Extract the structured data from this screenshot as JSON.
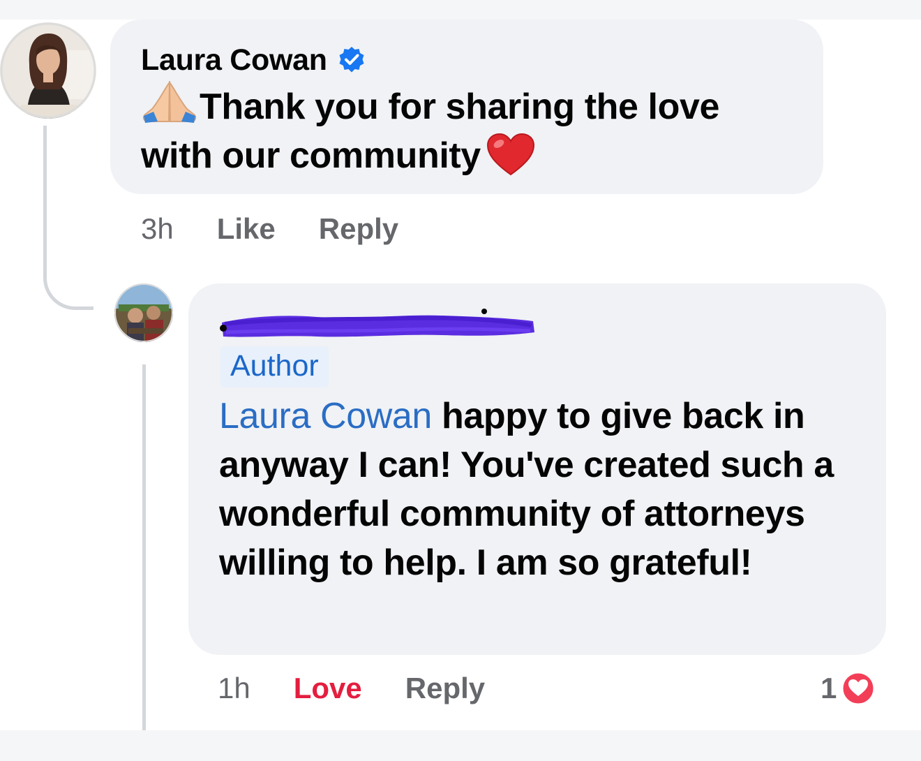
{
  "comment": {
    "author": "Laura Cowan",
    "verified": true,
    "emoji_prefix": "folded-hands",
    "text": "Thank you for sharing the love with our community",
    "emoji_suffix": "red-heart",
    "time": "3h",
    "like_label": "Like",
    "reply_label": "Reply"
  },
  "reply": {
    "author_redacted": true,
    "author_badge": "Author",
    "mention": "Laura Cowan",
    "text": " happy to give back in anyway I can! You've created such a wonderful community of attorneys willing to help. I am so grateful!",
    "time": "1h",
    "reaction_label": "Love",
    "reply_label": "Reply",
    "reaction_count": "1",
    "reaction_type": "love"
  },
  "colors": {
    "mention": "#2a6dc4",
    "love": "#e41e3f",
    "verified": "#1877f2",
    "redaction": "#5b2de0",
    "bubble": "#f0f2f5",
    "muted": "#65676b"
  }
}
